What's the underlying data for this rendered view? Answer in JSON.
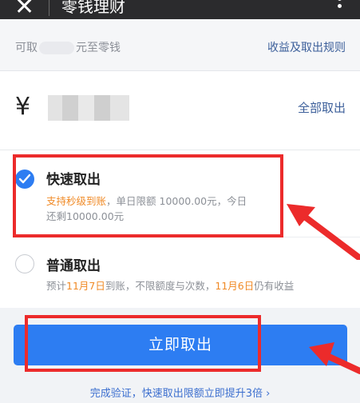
{
  "topbar": {
    "close_icon": "close-icon",
    "title": "零钱理财",
    "more_icon": "more-icon"
  },
  "info": {
    "available_prefix": "可取",
    "available_suffix": "元至零钱",
    "rules_link": "收益及取出规则"
  },
  "amount": {
    "currency_symbol": "¥",
    "withdraw_all": "全部取出"
  },
  "options": {
    "fast": {
      "title": "快速取出",
      "highlight": "支持秒级到账",
      "desc_line1": "，单日限额 10000.00元，今日",
      "desc_line2": "还剩10000.00元",
      "selected": true
    },
    "normal": {
      "title": "普通取出",
      "desc_prefix": "预计",
      "date1": "11月7日",
      "desc_mid": "到账，不限额度与次数，",
      "date2": "11月6日",
      "desc_suffix": "仍有收益",
      "selected": false
    }
  },
  "submit_button": "立即取出",
  "bottom_link": "完成验证，快速取出限额立即提升3倍 ›",
  "colors": {
    "primary": "#2d7df2",
    "link": "#3c5f9a",
    "highlight": "#f08a26",
    "annotation": "#ec2b2b"
  }
}
